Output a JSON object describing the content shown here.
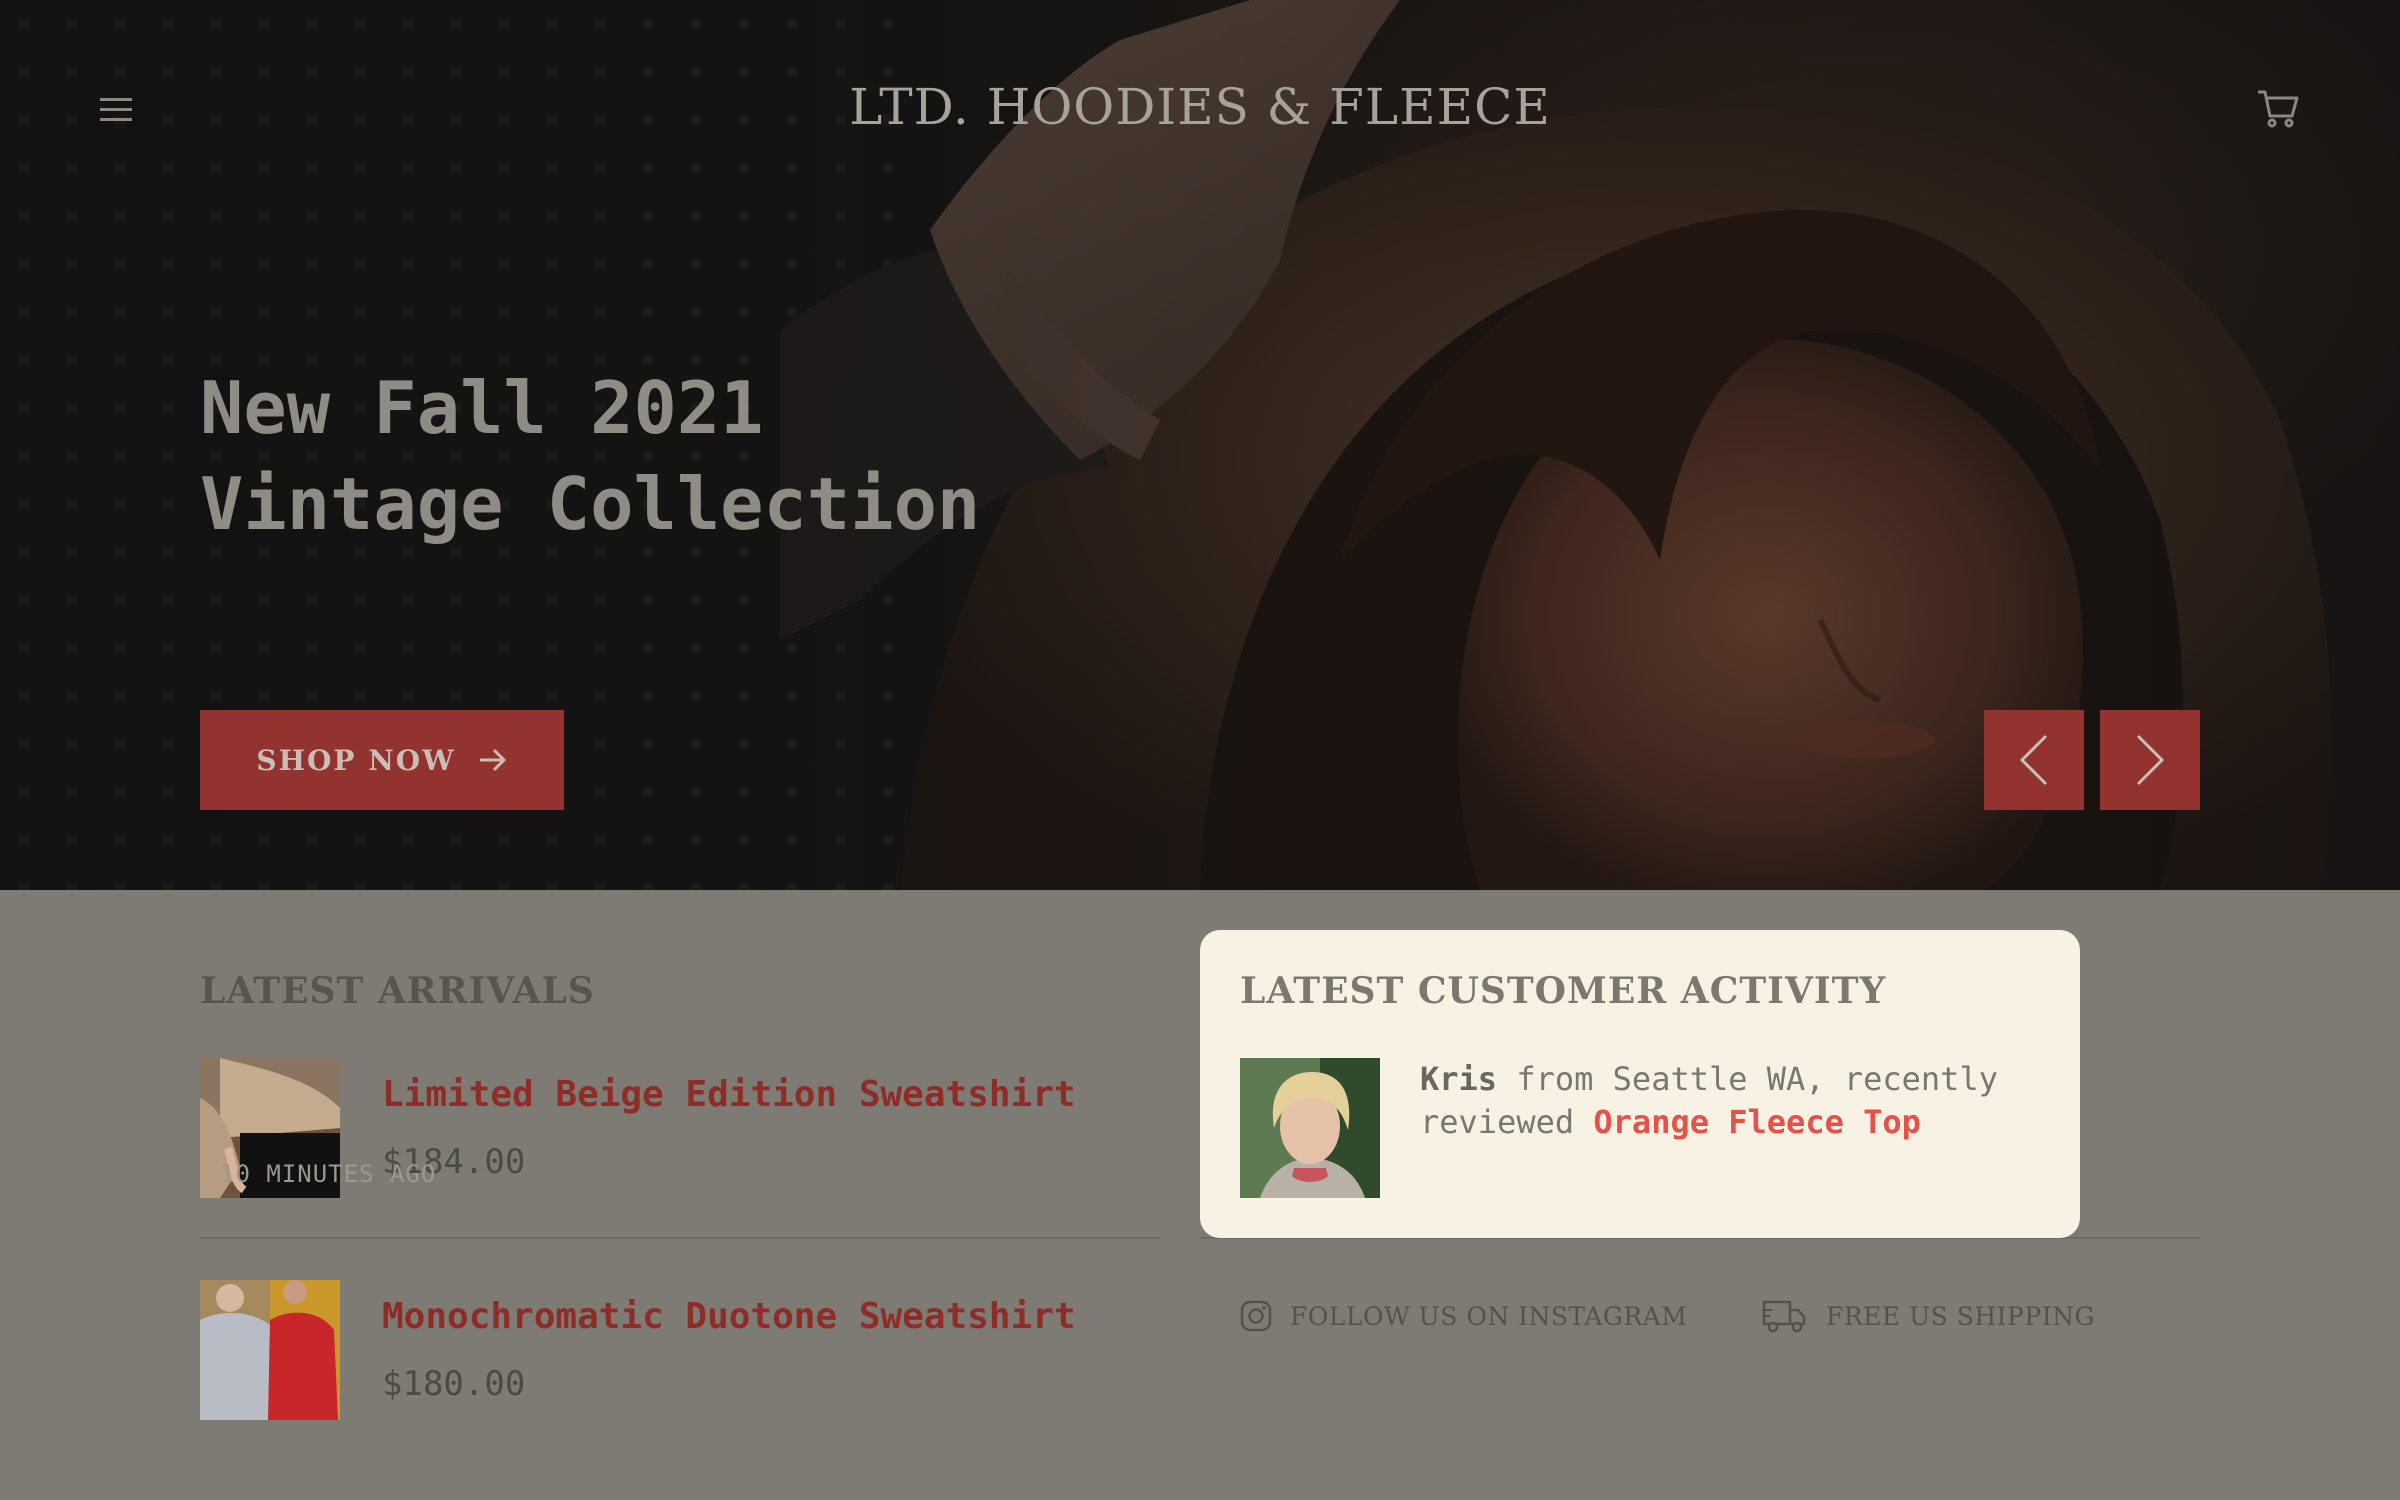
{
  "header": {
    "brand": "LTD. HOODIES & FLEECE",
    "menu_icon": "hamburger-menu-icon",
    "cart_icon": "shopping-cart-icon"
  },
  "hero": {
    "title_line1": "New Fall 2021",
    "title_line2": "Vintage Collection",
    "cta_label": "SHOP NOW",
    "cta_icon": "arrow-right-icon",
    "prev_icon": "chevron-left-icon",
    "next_icon": "chevron-right-icon"
  },
  "latest_arrivals": {
    "heading": "LATEST ARRIVALS",
    "items": [
      {
        "name": "Limited Beige Edition Sweatshirt",
        "price": "$184.00"
      },
      {
        "name": "Monochromatic Duotone Sweatshirt",
        "price": "$180.00"
      }
    ]
  },
  "customer_activity": {
    "heading": "LATEST CUSTOMER ACTIVITY",
    "customer": "Kris",
    "text_middle": " from Seattle WA, recently reviewed ",
    "product": "Orange Fleece Top",
    "time": "10 MINUTES AGO"
  },
  "footer_links": [
    {
      "label": "FOLLOW US ON INSTAGRAM",
      "icon": "instagram-icon"
    },
    {
      "label": "FREE US SHIPPING",
      "icon": "delivery-truck-icon"
    }
  ],
  "colors": {
    "accent": "#93332f",
    "product_link": "#8e2d28",
    "review_link": "#e6524a",
    "page_background": "#7e7b74",
    "card_background": "#f7f2e3"
  }
}
